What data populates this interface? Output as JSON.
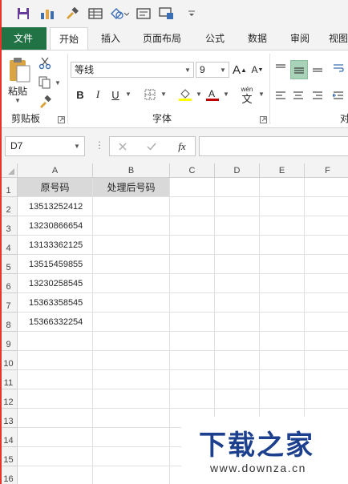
{
  "qat": {
    "icons": [
      "save-icon",
      "chart-icon",
      "format-painter-icon",
      "table-icon",
      "shapes-icon",
      "textbox-icon",
      "screen-icon",
      "customize-icon"
    ]
  },
  "tabs": [
    {
      "label": "文件"
    },
    {
      "label": "开始"
    },
    {
      "label": "插入"
    },
    {
      "label": "页面布局"
    },
    {
      "label": "公式"
    },
    {
      "label": "数据"
    },
    {
      "label": "审阅"
    },
    {
      "label": "视图"
    }
  ],
  "ribbon": {
    "paste_label": "粘贴",
    "clipboard_group": "剪贴板",
    "font_name": "等线",
    "font_size": "9",
    "font_group": "字体",
    "align_group": "对",
    "bold": "B",
    "italic": "I",
    "underline": "U",
    "grow_font": "A",
    "shrink_font": "A",
    "wen_label": "wén",
    "wen_char": "文"
  },
  "formula_bar": {
    "name_box": "D7",
    "fx": "fx",
    "formula": ""
  },
  "grid": {
    "columns": [
      "A",
      "B",
      "C",
      "D",
      "E",
      "F"
    ],
    "rows": [
      "1",
      "2",
      "3",
      "4",
      "5",
      "6",
      "7",
      "8",
      "9",
      "10",
      "11",
      "12",
      "13",
      "14",
      "15",
      "16"
    ],
    "header": {
      "a": "原号码",
      "b": "处理后号码"
    },
    "data": [
      "13513252412",
      "13230866654",
      "13133362125",
      "13515459855",
      "13230258545",
      "15363358545",
      "15366332254"
    ]
  },
  "watermark": {
    "title": "下载之家",
    "url": "www.downza.cn"
  },
  "colors": {
    "file_tab": "#217346",
    "font_color_bar": "#c00000",
    "highlight_bar": "#ffff00",
    "watermark_blue": "#1c3f8e"
  }
}
